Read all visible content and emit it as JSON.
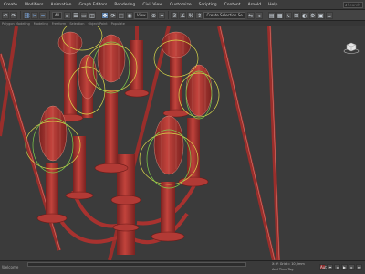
{
  "menu": {
    "items": [
      "Create",
      "Modifiers",
      "Animation",
      "Graph Editors",
      "Rendering",
      "Civil View",
      "Customize",
      "Scripting",
      "Content",
      "Arnold",
      "Help"
    ],
    "search_placeholder": "Search"
  },
  "toolbar": {
    "selection_filter": "All",
    "view_dropdown": "View",
    "named_selection": "Create Selection Se"
  },
  "subbar": {
    "items": [
      "Polygon Modeling",
      "Modeling",
      "Freeform",
      "Selection",
      "Object Paint",
      "Populate"
    ]
  },
  "viewport": {
    "label": "[+] [Perspective] [Standard] [Edged Faces]"
  },
  "statusbar": {
    "left_text": "Welcome",
    "x_label": "X:",
    "y_label": "Y:",
    "grid_text": "Grid = 10,0mm",
    "add_time_tag": "Add Time Tag",
    "auto_label": "Auto"
  },
  "colors": {
    "accent": "#5c7fa8",
    "mesh_red": "#a8322f",
    "mesh_highlight": "#e8a08f",
    "gizmo_yellow": "#d8d84a",
    "gizmo_green": "#7fcf4a"
  }
}
